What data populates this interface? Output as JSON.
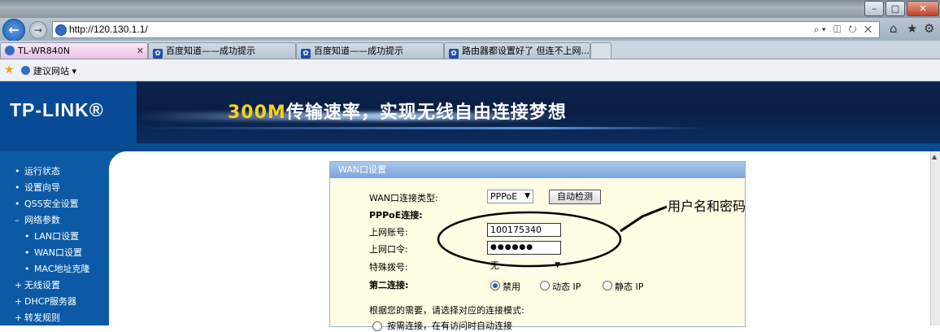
{
  "window": {
    "controls": [
      "–",
      "□",
      "✕"
    ]
  },
  "navbar": {
    "url": "http://120.130.1.1/",
    "addr_tools": "⌕▾ ◫ ↻ ✕"
  },
  "tabs": [
    {
      "label": "TL-WR840N",
      "active": true
    },
    {
      "label": "百度知道——成功提示",
      "active": false
    },
    {
      "label": "百度知道——成功提示",
      "active": false
    },
    {
      "label": "路由器都设置好了 但连不上网...",
      "active": false
    }
  ],
  "favbar": {
    "item": "建议网站 ▾"
  },
  "header": {
    "logo": "TP-LINK®",
    "slogan_highlight": "300M",
    "slogan_rest": "传输速率，实现无线自由连接梦想"
  },
  "sidebar": {
    "items": [
      {
        "label": "运行状态",
        "bullet": "•",
        "sub": false
      },
      {
        "label": "设置向导",
        "bullet": "•",
        "sub": false
      },
      {
        "label": "QSS安全设置",
        "bullet": "•",
        "sub": false
      },
      {
        "label": "网络参数",
        "bullet": "–",
        "sub": false
      },
      {
        "label": "LAN口设置",
        "bullet": "•",
        "sub": true
      },
      {
        "label": "WAN口设置",
        "bullet": "•",
        "sub": true
      },
      {
        "label": "MAC地址克隆",
        "bullet": "•",
        "sub": true
      },
      {
        "label": "无线设置",
        "bullet": "+",
        "sub": false
      },
      {
        "label": "DHCP服务器",
        "bullet": "+",
        "sub": false
      },
      {
        "label": "转发规则",
        "bullet": "+",
        "sub": false
      }
    ]
  },
  "wan": {
    "title": "WAN口设置",
    "type_label": "WAN口连接类型:",
    "type_value": "PPPoE",
    "detect_button": "自动检测",
    "pppoe_heading": "PPPoE连接:",
    "account_label": "上网账号:",
    "account_value": "100175340",
    "password_label": "上网口令:",
    "password_value": "●●●●●●",
    "dial_label": "特殊拨号:",
    "dial_value": "无",
    "second_label": "第二连接:",
    "second_options": [
      {
        "label": "禁用",
        "checked": true
      },
      {
        "label": "动态 IP",
        "checked": false
      },
      {
        "label": "静态 IP",
        "checked": false
      }
    ],
    "mode_note": "根据您的需要，请选择对应的连接模式:",
    "mode_option_partial": "按需连接，在有访问时自动连接"
  },
  "annotation": {
    "text": "用户名和密码"
  },
  "colors": {
    "sidebar": "#0c5aa6",
    "panel_bg": "#fffde3",
    "panel_title": "#7ba6db",
    "header": "#0a4a91"
  }
}
